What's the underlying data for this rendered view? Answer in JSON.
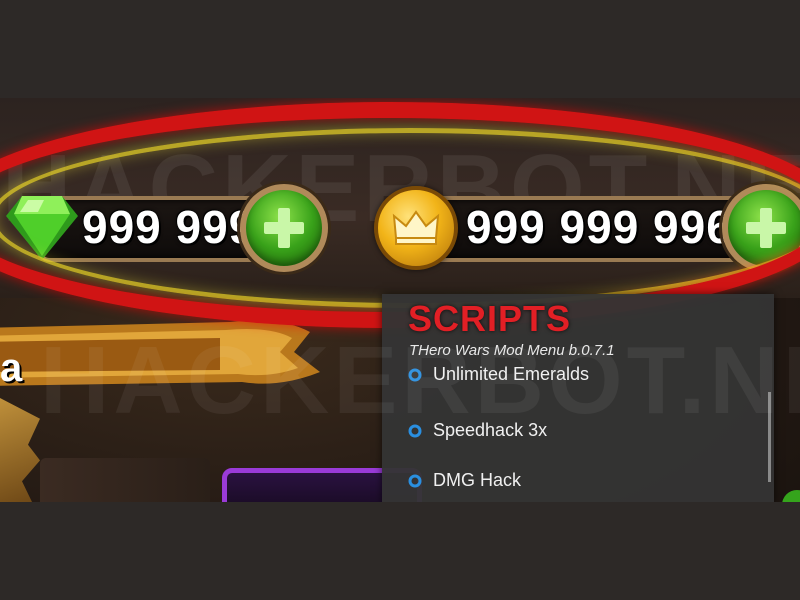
{
  "hud": {
    "gems_amount": "999 999",
    "gold_amount": "999 999 996"
  },
  "mod_menu": {
    "title": "SCRIPTS",
    "subtitle": "THero Wars Mod Menu b.0.7.1",
    "items": [
      {
        "label": "Unlimited Emeralds"
      },
      {
        "label": "Speedhack 3x"
      },
      {
        "label": "DMG Hack"
      }
    ]
  },
  "watermark": {
    "line1": "HACKERBOT.NET",
    "line2": "HACKERBOT.NET"
  },
  "ribbon_text": "a",
  "colors": {
    "highlight_oval": "#d01414",
    "menu_title": "#e21f25",
    "plus_button": "#39a21a",
    "gem": "#5fd23a",
    "coin": "#f2b418",
    "menu_background": "#343434"
  },
  "icons": {
    "gems": "green-gem-icon",
    "gold": "crown-coin-icon",
    "add": "plus-icon",
    "menu_bullet": "ring-icon"
  }
}
